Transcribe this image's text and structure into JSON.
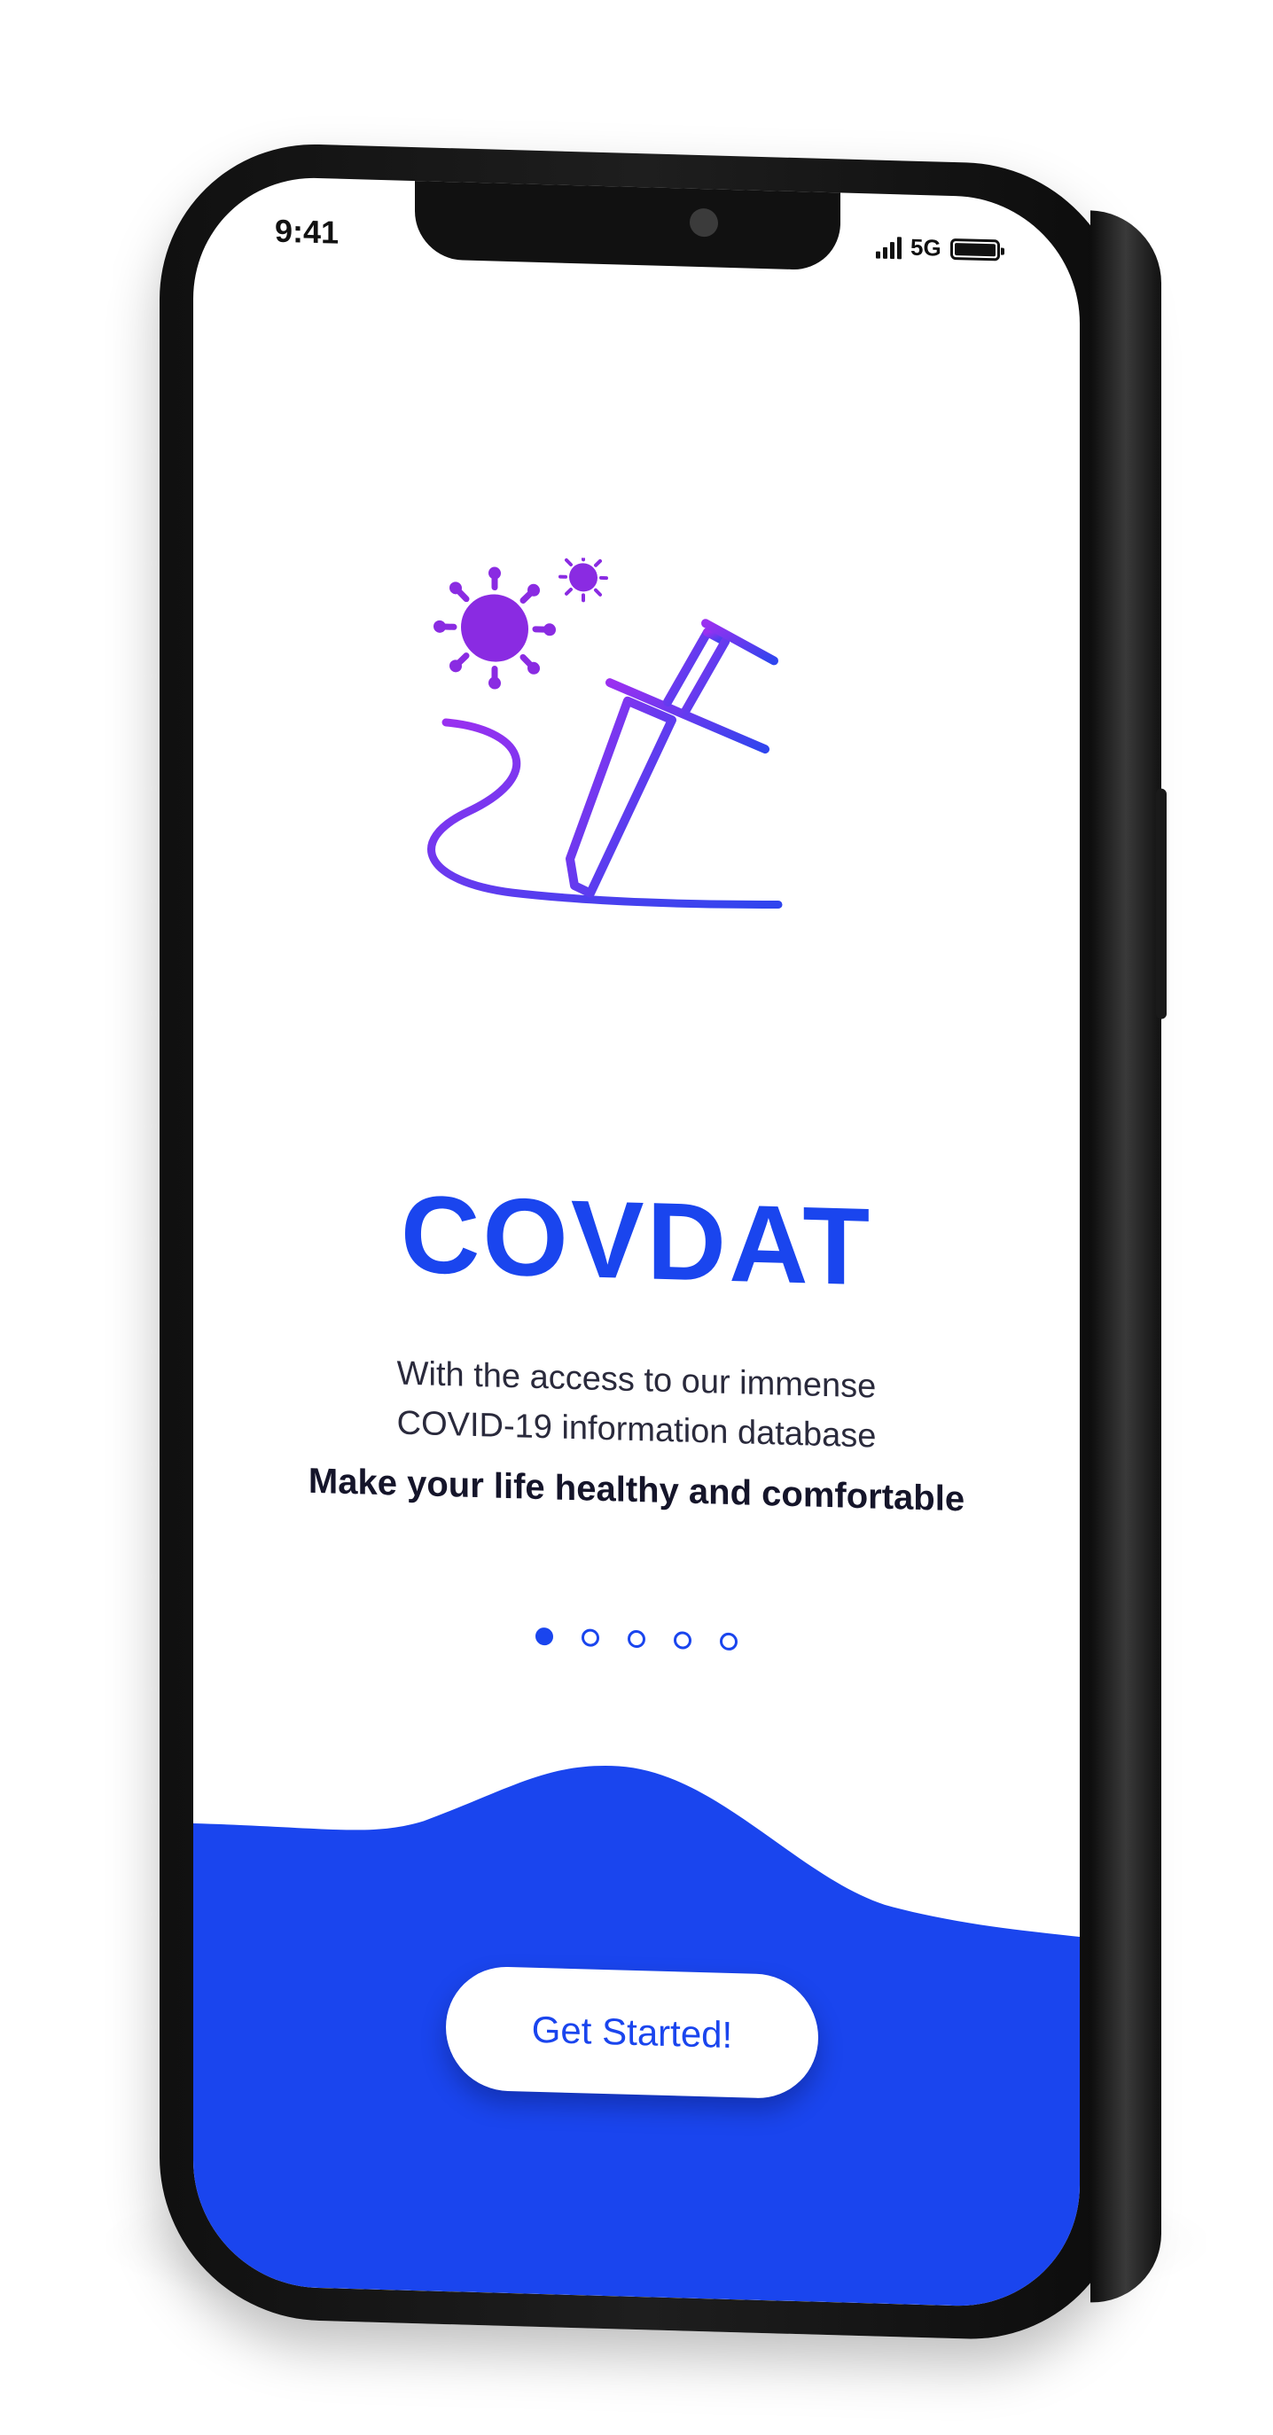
{
  "status_bar": {
    "time": "9:41",
    "network": "5G",
    "signal_icon": "signal-bars-icon",
    "battery_icon": "battery-full-icon"
  },
  "onboarding": {
    "illustration_icon": "syringe-virus-illustration-icon",
    "title": "COVDAT",
    "tagline_line1": "With the access to our immense",
    "tagline_line2": "COVID-19 information database",
    "slogan": "Make your life healthy and comfortable",
    "pager": {
      "total": 5,
      "active_index": 0
    },
    "cta_label": "Get Started!"
  },
  "colors": {
    "brand_blue": "#1a45ee",
    "illustration_purple": "#8a2be2",
    "text_dark": "#15152a"
  }
}
